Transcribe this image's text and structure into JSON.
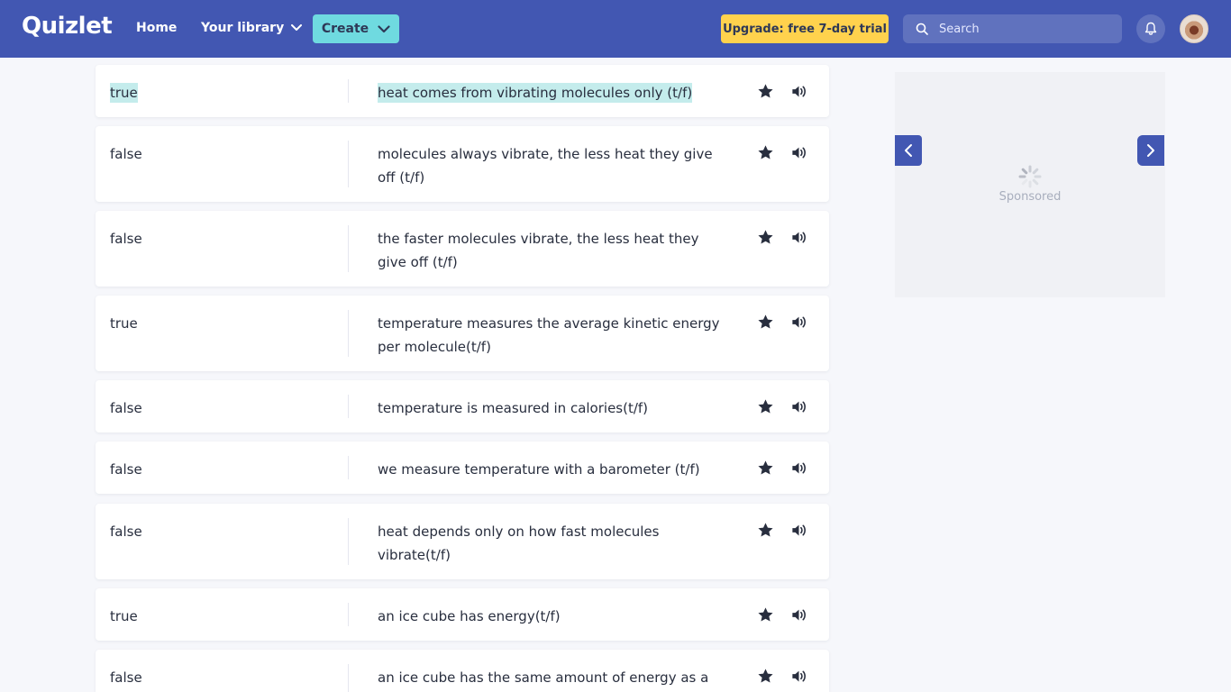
{
  "header": {
    "logo": "Quizlet",
    "nav": {
      "home": "Home",
      "library": "Your library",
      "create": "Create"
    },
    "upgrade": "Upgrade: free 7-day trial",
    "search_placeholder": "Search"
  },
  "cards": [
    {
      "term": "true",
      "definition": "heat comes from vibrating molecules only (t/f)",
      "highlighted": true
    },
    {
      "term": "false",
      "definition": "molecules always vibrate, the less heat they give off (t/f)",
      "highlighted": false
    },
    {
      "term": "false",
      "definition": "the faster molecules vibrate, the less heat they give off (t/f)",
      "highlighted": false
    },
    {
      "term": "true",
      "definition": "temperature measures the average kinetic energy per molecule(t/f)",
      "highlighted": false
    },
    {
      "term": "false",
      "definition": "temperature is measured in calories(t/f)",
      "highlighted": false
    },
    {
      "term": "false",
      "definition": "we measure temperature with a barometer (t/f)",
      "highlighted": false
    },
    {
      "term": "false",
      "definition": "heat depends only on how fast molecules vibrate(t/f)",
      "highlighted": false
    },
    {
      "term": "true",
      "definition": "an ice cube has energy(t/f)",
      "highlighted": false
    },
    {
      "term": "false",
      "definition": "an ice cube has the same amount of energy as a",
      "highlighted": false
    }
  ],
  "ad": {
    "label": "Sponsored"
  },
  "colors": {
    "header_bg": "#4257b2",
    "create_bg": "#6fdae0",
    "upgrade_bg": "#ffd24d",
    "highlight": "#c4ecec",
    "page_bg": "#f6f7fb"
  }
}
